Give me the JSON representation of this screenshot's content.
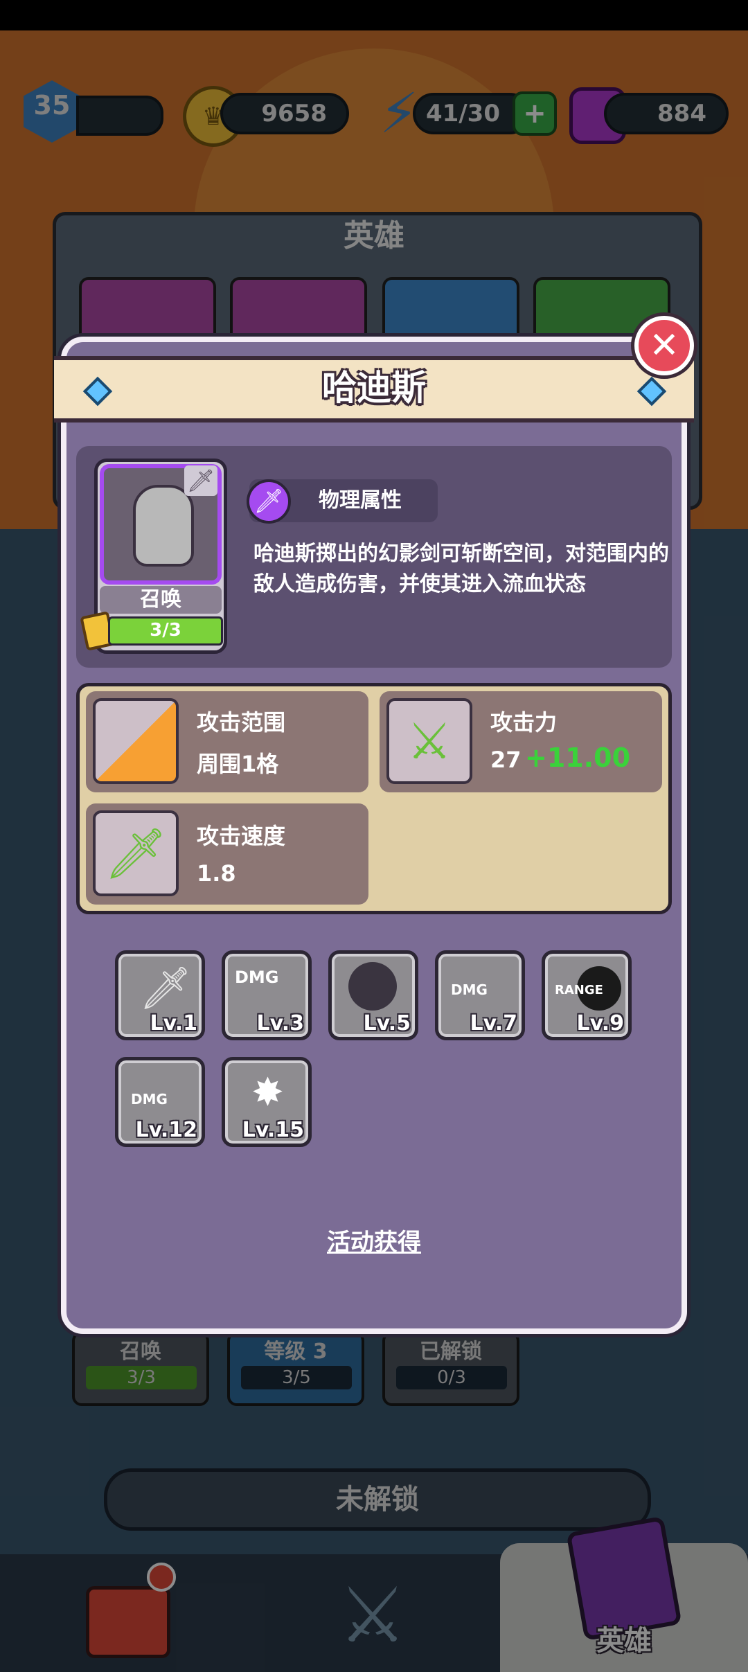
{
  "topbar": {
    "level": "35",
    "gold": "9658",
    "energy": "41/30",
    "gems": "884"
  },
  "heroes_panel": {
    "title": "英雄"
  },
  "behind_stats": {
    "summon_label": "召唤",
    "summon_value": "3/3",
    "level_label": "等级 3",
    "level_value": "3/5",
    "unlocked_label": "已解锁",
    "unlocked_value": "0/3"
  },
  "unlock_button": "未解锁",
  "nav": {
    "heroes_label": "英雄"
  },
  "modal": {
    "title": "哈迪斯",
    "close_icon": "close-icon",
    "portrait": {
      "summon_label": "召唤",
      "progress": "3/3"
    },
    "attribute": "物理属性",
    "description": "哈迪斯掷出的幻影剑可斩断空间，对范围内的敌人造成伤害，并使其进入流血状态",
    "stats": {
      "range_label": "攻击范围",
      "range_value": "周围1格",
      "attack_label": "攻击力",
      "attack_value": "27",
      "attack_bonus": "+11.00",
      "speed_label": "攻击速度",
      "speed_value": "1.8"
    },
    "skills": [
      {
        "level": "Lv.1",
        "icon": "swords-icon"
      },
      {
        "level": "Lv.3",
        "icon": "dmg-up-icon"
      },
      {
        "level": "Lv.5",
        "icon": "blood-splash-icon"
      },
      {
        "level": "Lv.7",
        "icon": "dmg-up-face-icon"
      },
      {
        "level": "Lv.9",
        "icon": "range-up-icon"
      },
      {
        "level": "Lv.12",
        "icon": "dmg-up-chain-icon"
      },
      {
        "level": "Lv.15",
        "icon": "burst-icon"
      }
    ],
    "obtain_link": "活动获得"
  },
  "colors": {
    "accent_purple": "#a54bf0",
    "bonus_green": "#3ad23a",
    "close_red": "#e74a5a"
  }
}
